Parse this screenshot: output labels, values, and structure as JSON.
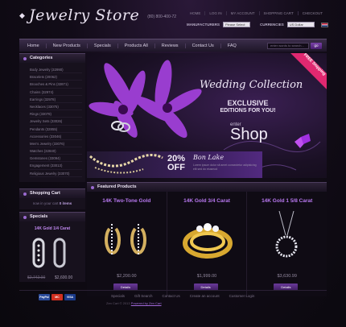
{
  "header": {
    "logo": "Jewelry Store",
    "phone": "(80) 800-400-72",
    "top_links": [
      "Home",
      "Log in",
      "My account",
      "Shopping cart",
      "Checkout"
    ],
    "manufacturers_label": "Manufacturers",
    "manufacturers_value": "Please Select",
    "currencies_label": "Currencies",
    "currencies_value": "US Dollar"
  },
  "nav": {
    "items": [
      "Home",
      "New Products",
      "Specials",
      "Products All",
      "Reviews",
      "Contact Us",
      "FAQ"
    ],
    "search_placeholder": "enter words to search...",
    "go_label": "go"
  },
  "categories": {
    "title": "Categories",
    "items": [
      "Body Jewelry (32990)",
      "Bracelets (20062)",
      "Brooches & Pins (32871)",
      "Chains (32974)",
      "Earrings (32978)",
      "Necklaces (33075)",
      "Rings (33078)",
      "Jewelry Sets (33026)",
      "Pendants (32855)",
      "Accessories (33046)",
      "Men's Jewelry (33076)",
      "Watches (32840)",
      "Gemstones (33094)",
      "Engagement (33013)",
      "Religious Jewelry (33070)"
    ]
  },
  "cart": {
    "title": "Shopping Cart",
    "prefix": "now in your cart",
    "count": "0 items"
  },
  "specials": {
    "title": "Specials",
    "product": "14K Gold 1/4 Carat",
    "old_price": "$2,742.00",
    "new_price": "$2,600.00"
  },
  "banner": {
    "title": "Wedding Collection",
    "line1": "EXCLUSIVE",
    "line2": "EDITIONS FOR YOU!",
    "enter": "enter",
    "shop": "Shop",
    "ribbon": "FREE Shipping",
    "promo_percent": "20%",
    "promo_off": "OFF",
    "promo_brand": "Bon Lake",
    "promo_desc": "Lorem ipsum dolor sit amet consectetur adipisicing elit sed do eiusmod"
  },
  "featured": {
    "title": "Featured Products",
    "products": [
      {
        "name": "14K Two-Tone Gold",
        "price": "$2,200.00",
        "button": "Details"
      },
      {
        "name": "14K Gold 3/4 Carat",
        "price": "$1,999.00",
        "button": "Details"
      },
      {
        "name": "14K Gold 1 5/8 Carat",
        "price": "$3,630.99",
        "button": "Details"
      }
    ]
  },
  "footer": {
    "cards": [
      "PayPal",
      "MC",
      "VISA"
    ],
    "links": [
      "Specials",
      "Gift Search",
      "Contact Us",
      "Create an account",
      "Customer Login"
    ],
    "copyright": "Zen Cart © 2013",
    "powered": "Powered by Zen Cart"
  }
}
